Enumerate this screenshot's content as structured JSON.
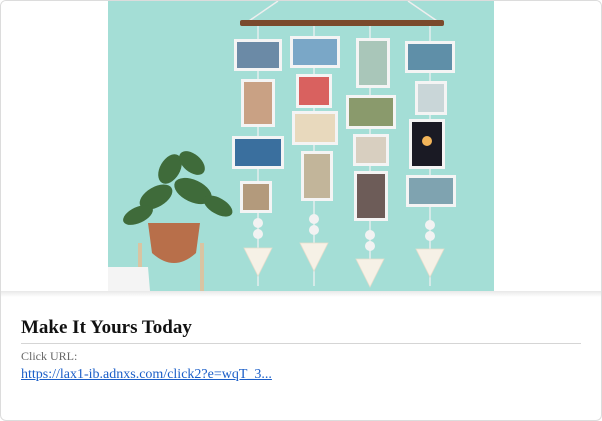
{
  "ad": {
    "title": "Make It Yours Today",
    "click_label": "Click URL:",
    "click_url": "https://lax1-ib.adnxs.com/click2?e=wqT_3..."
  },
  "colors": {
    "wall": "#9fdcd4",
    "link": "#1a5ec8"
  },
  "icons": [
    "photo-display-image"
  ]
}
